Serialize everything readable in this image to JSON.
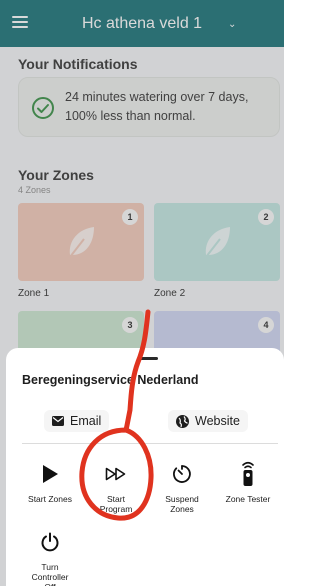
{
  "app_bar": {
    "title": "Hc athena veld 1",
    "chevron": "⌄",
    "menu_icon": "hamburger-menu-icon"
  },
  "notifications": {
    "heading": "Your Notifications",
    "message": "24 minutes watering over 7 days, 100% less than normal.",
    "icon": "check-circle-icon",
    "accent": "#2e8b3c"
  },
  "zones": {
    "heading": "Your Zones",
    "count_label": "4 Zones",
    "items": [
      {
        "number": "1",
        "label": "Zone 1",
        "color": "#f3c8b7"
      },
      {
        "number": "2",
        "label": "Zone 2",
        "color": "#bfe6e1"
      },
      {
        "number": "3",
        "label": "",
        "color": "#c9e6cf"
      },
      {
        "number": "4",
        "label": "",
        "color": "#cdd4f3"
      }
    ]
  },
  "sheet": {
    "title": "Beregeningservice Nederland",
    "email_label": "Email",
    "website_label": "Website",
    "actions": [
      {
        "label": "Start Zones",
        "icon": "play-icon"
      },
      {
        "label": "Start Program",
        "icon": "fast-forward-icon"
      },
      {
        "label": "Suspend Zones",
        "icon": "timer-icon"
      },
      {
        "label": "Zone Tester",
        "icon": "remote-icon"
      },
      {
        "label": "Turn Controller Off",
        "icon": "power-icon"
      }
    ]
  },
  "colors": {
    "app_bar": "#0f6c72",
    "annotation_stroke": "#e0331f"
  }
}
